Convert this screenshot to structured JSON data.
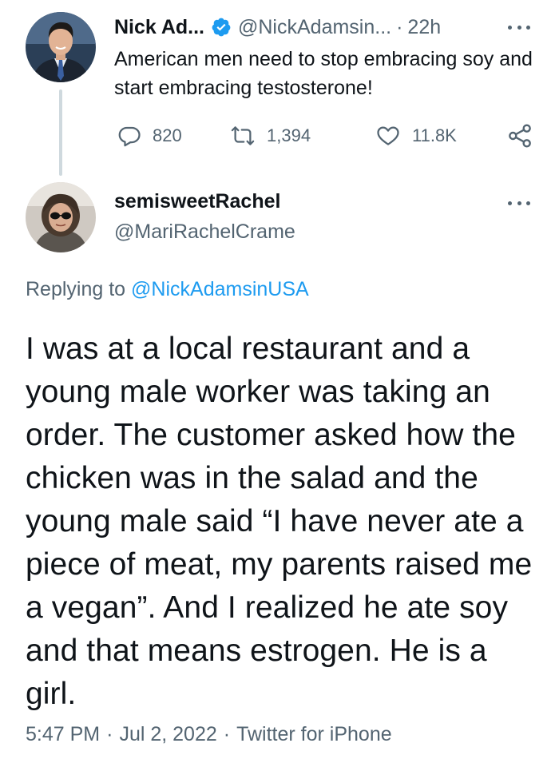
{
  "parent_tweet": {
    "author_name": "Nick Ad...",
    "verified": true,
    "handle": "@NickAdamsin...",
    "separator": "·",
    "time": "22h",
    "text": "American men need to stop embracing soy and start embracing testosterone!",
    "actions": {
      "replies": "820",
      "retweets": "1,394",
      "likes": "11.8K"
    },
    "icons": [
      "reply-icon",
      "retweet-icon",
      "like-icon",
      "share-icon",
      "more-icon",
      "verified-badge-icon"
    ]
  },
  "main_tweet": {
    "author_name": "semisweetRachel",
    "handle": "@MariRachelCrame",
    "replying_prefix": "Replying to",
    "replying_to": "@NickAdamsinUSA",
    "text": "I was at a local restaurant and a young male worker was taking an order. The customer asked how the chicken was in the salad and the young male said “I have never ate a piece of meat, my parents raised me a vegan”. And I realized he ate soy and that means estrogen. He is a girl.",
    "timestamp_time": "5:47 PM",
    "timestamp_date": "Jul 2, 2022",
    "source": "Twitter for iPhone",
    "separator": "·"
  },
  "colors": {
    "text_primary": "#0f1419",
    "text_secondary": "#536471",
    "link_blue": "#1d9bf0",
    "verified_blue": "#1d9bf0",
    "thread_line": "#cfd9de",
    "background": "#ffffff"
  }
}
